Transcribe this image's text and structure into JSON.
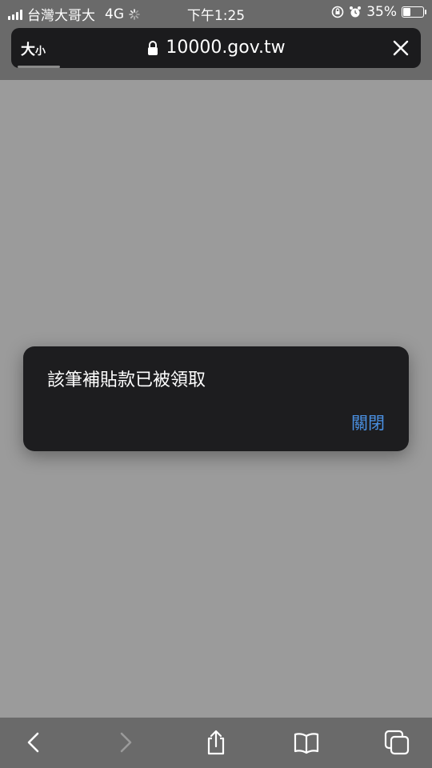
{
  "status_bar": {
    "carrier": "台灣大哥大",
    "network": "4G",
    "time": "下午1:25",
    "battery": "35%"
  },
  "url_bar": {
    "text_size_big": "大",
    "text_size_small": "小",
    "address": "10000.gov.tw"
  },
  "alert": {
    "message": "該筆補貼款已被領取",
    "close_label": "關閉"
  },
  "colors": {
    "accent": "#4a90e2",
    "dialog": "#1d1d1f",
    "page": "#9b9b9b"
  },
  "toolbar": {
    "icons": [
      "back-icon",
      "forward-icon",
      "share-icon",
      "bookmarks-icon",
      "tabs-icon"
    ]
  }
}
